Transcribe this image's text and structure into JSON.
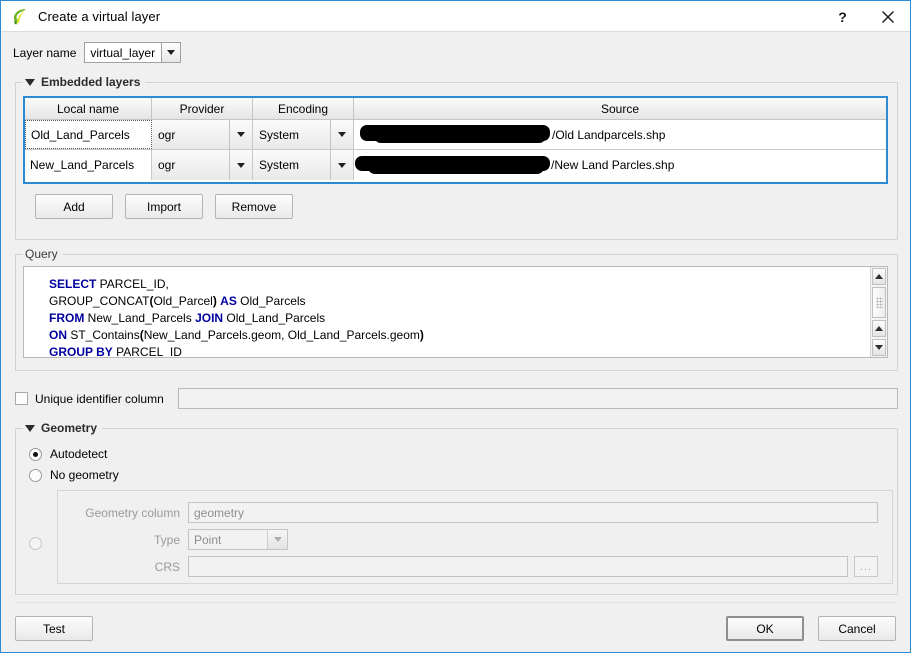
{
  "window": {
    "title": "Create a virtual layer",
    "icon": "qgis-leaf-icon",
    "help_label": "?",
    "close_label": "✕"
  },
  "layer_name": {
    "label": "Layer name",
    "value": "virtual_layer"
  },
  "embedded_layers": {
    "group_title": "Embedded layers",
    "columns": [
      "Local name",
      "Provider",
      "Encoding",
      "Source"
    ],
    "rows": [
      {
        "local_name": "Old_Land_Parcels",
        "provider": "ogr",
        "encoding": "System",
        "source": "/Old Landparcels.shp"
      },
      {
        "local_name": "New_Land_Parcels",
        "provider": "ogr",
        "encoding": "System",
        "source": "/New Land Parcles.shp"
      }
    ],
    "buttons": {
      "add": "Add",
      "import": "Import",
      "remove": "Remove"
    }
  },
  "query": {
    "group_title": "Query",
    "lines": [
      "SELECT PARCEL_ID,",
      "GROUP_CONCAT(Old_Parcel) AS Old_Parcels",
      "FROM New_Land_Parcels JOIN Old_Land_Parcels",
      "ON ST_Contains(New_Land_Parcels.geom, Old_Land_Parcels.geom)",
      "GROUP BY PARCEL_ID"
    ]
  },
  "unique_identifier": {
    "label": "Unique identifier column",
    "checked": false,
    "value": ""
  },
  "geometry": {
    "group_title": "Geometry",
    "options": [
      {
        "label": "Autodetect",
        "selected": true
      },
      {
        "label": "No geometry",
        "selected": false
      },
      {
        "label": "",
        "selected": false
      }
    ],
    "fields": {
      "geometry_column_label": "Geometry column",
      "geometry_column_value": "geometry",
      "type_label": "Type",
      "type_value": "Point",
      "crs_label": "CRS",
      "crs_value": "",
      "browse_label": "..."
    }
  },
  "footer": {
    "test": "Test",
    "ok": "OK",
    "cancel": "Cancel"
  },
  "colors": {
    "accent": "#2d8bd4",
    "sql_keyword": "#00009f",
    "window_bg": "#f0f0f0"
  }
}
